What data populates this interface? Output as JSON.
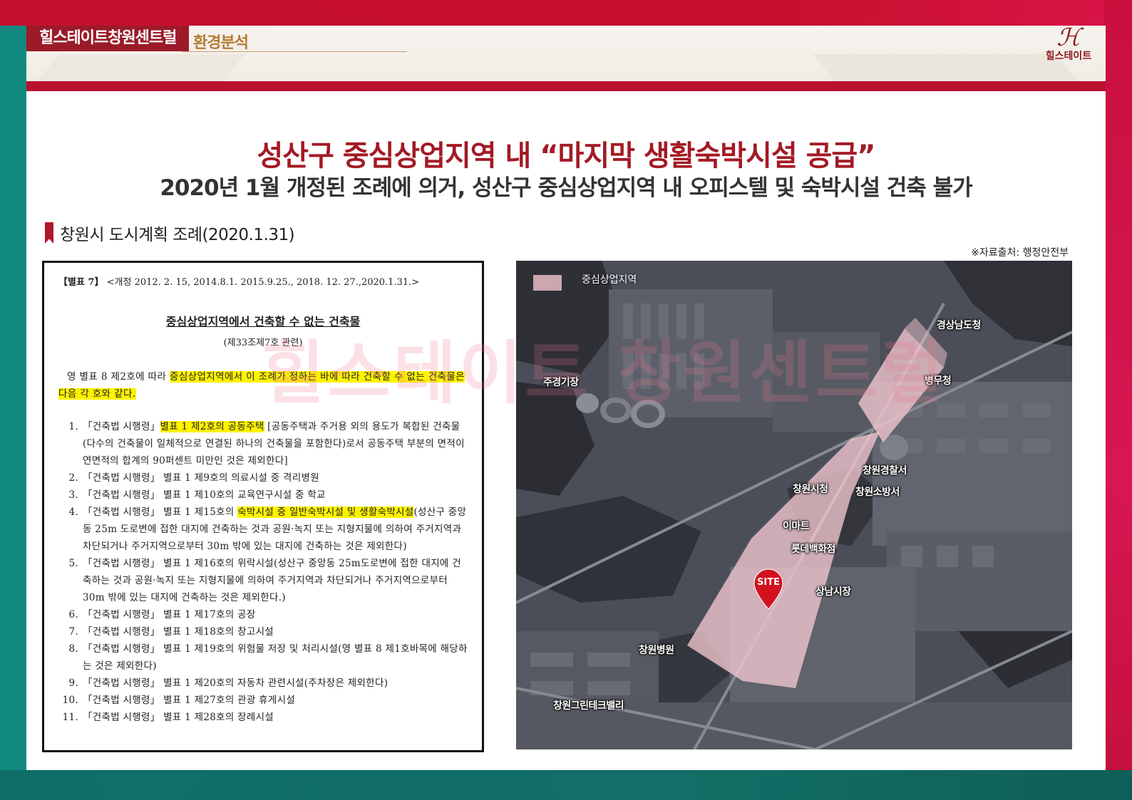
{
  "header": {
    "brand": "힐스테이트창원센트럴",
    "section": "환경분석",
    "logo_text": "힐스테이트"
  },
  "title": {
    "main": "성산구 중심상업지역 내 “마지막 생활숙박시설 공급”",
    "sub": "2020년 1월 개정된 조례에 의거, 성산구 중심상업지역 내 오피스텔 및 숙박시설 건축 불가"
  },
  "section_heading": "창원시 도시계획 조례(2020.1.31)",
  "source": "※자료출처: 행정안전부",
  "document": {
    "head_bold": "【별표 7】",
    "head_rest": "<개정 2012. 2. 15, 2014.8.1. 2015.9.25., 2018. 12. 27.,2020.1.31.>",
    "title": "중심상업지역에서 건축할 수 없는 건축물",
    "subtitle": "(제33조제7호 관련)",
    "intro_plain": "영 별표 8 제2호에 따라 ",
    "intro_highlight": "중심상업지역에서 이 조례가 정하는 바에 따라 건축할 수 없는 건축물은 다음 각 호와 같다.",
    "items": [
      {
        "num": "1.",
        "pre": "「건축법 시행령」",
        "highlight": "별표 1 제2호의 공동주택",
        "post": " [공동주택과 주거용 외의 용도가 복합된 건축물(다수의 건축물이 일체적으로 연결된 하나의 건축물을 포함한다)로서 공동주택 부분의 면적이 연면적의 합계의 90퍼센트 미만인 것은 제외한다]"
      },
      {
        "num": "2.",
        "pre": "「건축법 시행령」 별표 1 제9호의 의료시설 중 격리병원",
        "highlight": "",
        "post": ""
      },
      {
        "num": "3.",
        "pre": "「건축법 시행령」 별표 1 제10호의 교육연구시설 중 학교",
        "highlight": "",
        "post": ""
      },
      {
        "num": "4.",
        "pre": "「건축법 시행령」 별표 1 제15호의 ",
        "highlight": "숙박시설 중 일반숙박시설 및 생활숙박시설",
        "post": "(성산구 중앙동 25m 도로변에 접한 대지에 건축하는 것과 공원·녹지 또는 지형지물에 의하여 주거지역과 차단되거나 주거지역으로부터 30m 밖에 있는 대지에 건축하는 것은 제외한다)"
      },
      {
        "num": "5.",
        "pre": "「건축법 시행령」 별표 1 제16호의 위락시설(성산구 중앙동 25m도로변에 접한 대지에 건축하는 것과 공원·녹지 또는 지형지물에 의하여 주거지역과 차단되거나 주거지역으로부터 30m 밖에 있는 대지에 건축하는 것은 제외한다.)",
        "highlight": "",
        "post": ""
      },
      {
        "num": "6.",
        "pre": "「건축법 시행령」 별표 1 제17호의 공장",
        "highlight": "",
        "post": ""
      },
      {
        "num": "7.",
        "pre": "「건축법 시행령」 별표 1 제18호의 창고시설",
        "highlight": "",
        "post": ""
      },
      {
        "num": "8.",
        "pre": "「건축법 시행령」 별표 1 제19호의 위험물 저장 및 처리시설(영 별표 8 제1호바목에 해당하는 것은 제외한다)",
        "highlight": "",
        "post": ""
      },
      {
        "num": "9.",
        "pre": "「건축법 시행령」 별표 1 제20호의 자동차 관련시설(주차장은 제외한다)",
        "highlight": "",
        "post": ""
      },
      {
        "num": "10.",
        "pre": "「건축법 시행령」 별표 1 제27호의 관광 휴게시설",
        "highlight": "",
        "post": ""
      },
      {
        "num": "11.",
        "pre": "「건축법 시행령」 별표 1 제28호의 장례시설",
        "highlight": "",
        "post": ""
      }
    ]
  },
  "map": {
    "legend": "중심상업지역",
    "labels": {
      "gyeongnam": "경상남도청",
      "juyeong": "주경기장",
      "byeongmu": "병무청",
      "police": "창원경찰서",
      "cityhall": "창원시청",
      "fire": "창원소방서",
      "emart": "이마트",
      "lotte": "롯데백화점",
      "sangnam": "상남시장",
      "hospital": "창원병원",
      "greentech": "창원그린테크밸리"
    },
    "site": "SITE"
  },
  "watermark": "힐스테이트 창원센트럴",
  "colors": {
    "brand_red": "#a31a25",
    "highlight": "#fff200",
    "zone_pink": "#f2c6cf"
  }
}
